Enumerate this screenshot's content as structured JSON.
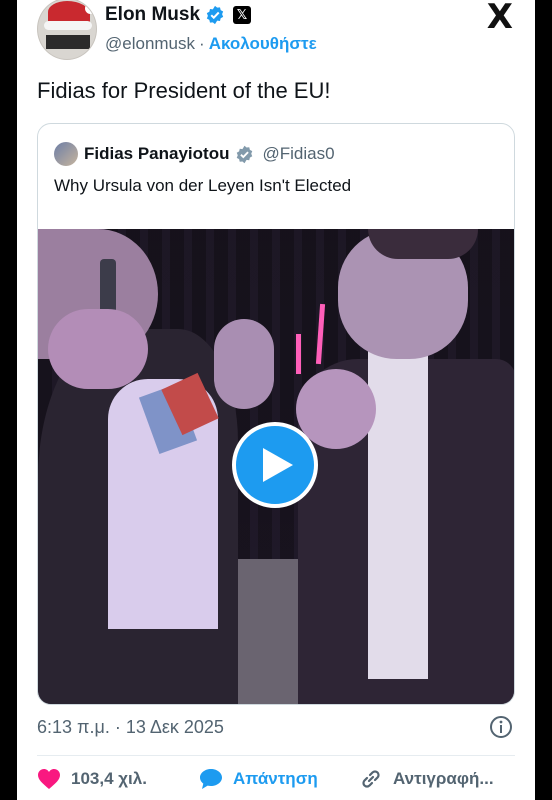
{
  "author": {
    "name": "Elon Musk",
    "handle": "@elonmusk",
    "separator": "·",
    "follow_label": "Ακολουθήστε",
    "badge_x": "𝕏"
  },
  "close_glyph": "X",
  "tweet": {
    "text": "Fidias for President of the EU!",
    "timestamp": "6:13 π.μ. · 13 Δεκ 2025"
  },
  "quoted": {
    "name": "Fidias Panayiotou",
    "handle": "@Fidias0",
    "text": "Why Ursula von der Leyen Isn't Elected"
  },
  "actions": {
    "likes": "103,4 χιλ.",
    "reply": "Απάντηση",
    "copy": "Αντιγραφή..."
  },
  "colors": {
    "accent": "#1d9bf0",
    "like": "#f91880",
    "text": "#0f1419",
    "muted": "#536471"
  },
  "icons": [
    "verified-badge-icon",
    "x-logo-icon",
    "close-icon",
    "play-icon",
    "info-icon",
    "heart-icon",
    "reply-bubble-icon",
    "link-icon"
  ]
}
